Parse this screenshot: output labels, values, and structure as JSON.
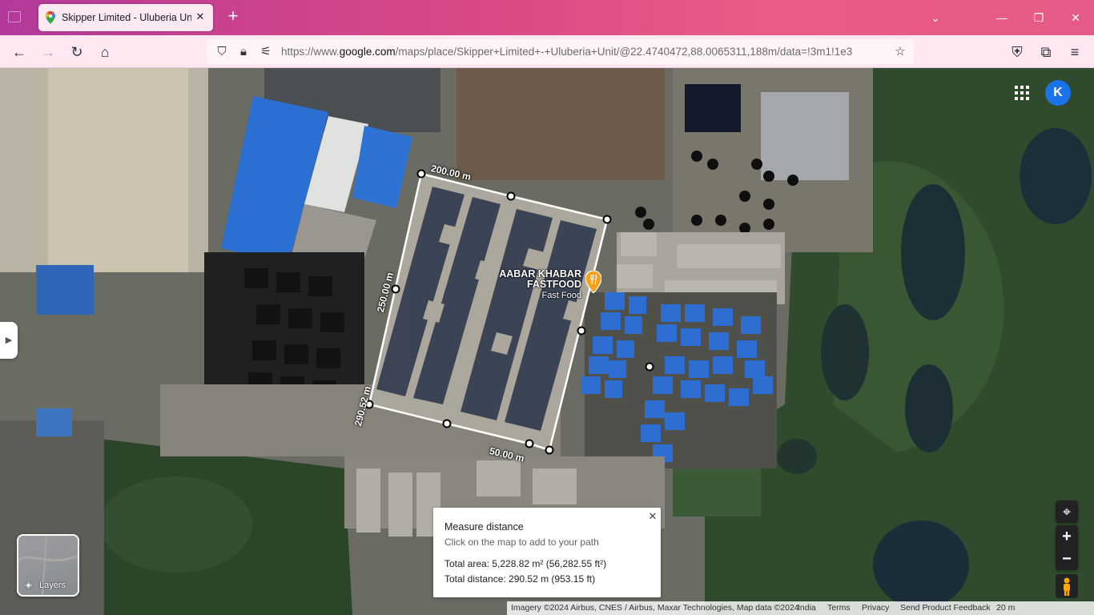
{
  "browser": {
    "tab_title": "Skipper Limited - Uluberia Unit",
    "url_prefix": "https://www.",
    "url_host": "google.com",
    "url_path": "/maps/place/Skipper+Limited+-+Uluberia+Unit/@22.4740472,88.0065311,188m/data=!3m1!1e3",
    "new_tab_label": "+",
    "tab_close_label": "✕"
  },
  "map": {
    "account_initial": "K",
    "poi": {
      "name_line1": "AABAR KHABAR",
      "name_line2": "FASTFOOD",
      "category": "Fast Food"
    },
    "segment_labels": {
      "top": "200.00 m",
      "left": "250.00 m",
      "left_lower": "290.52 m",
      "bottom": "50.00 m"
    },
    "layers_label": "Layers"
  },
  "measure": {
    "title": "Measure distance",
    "hint": "Click on the map to add to your path",
    "total_area": "Total area: 5,228.82 m² (56,282.55 ft²)",
    "total_distance": "Total distance: 290.52 m (953.15 ft)"
  },
  "footer": {
    "attribution": "Imagery ©2024 Airbus, CNES / Airbus, Maxar Technologies, Map data ©2024",
    "region": "India",
    "terms": "Terms",
    "privacy": "Privacy",
    "feedback": "Send Product Feedback",
    "scale": "20 m"
  },
  "colors": {
    "accent_blue": "#1a73e8",
    "tab_gradient_start": "#b23a9b",
    "tab_gradient_end": "#e55a86",
    "poi_pin": "#f4a11b"
  }
}
